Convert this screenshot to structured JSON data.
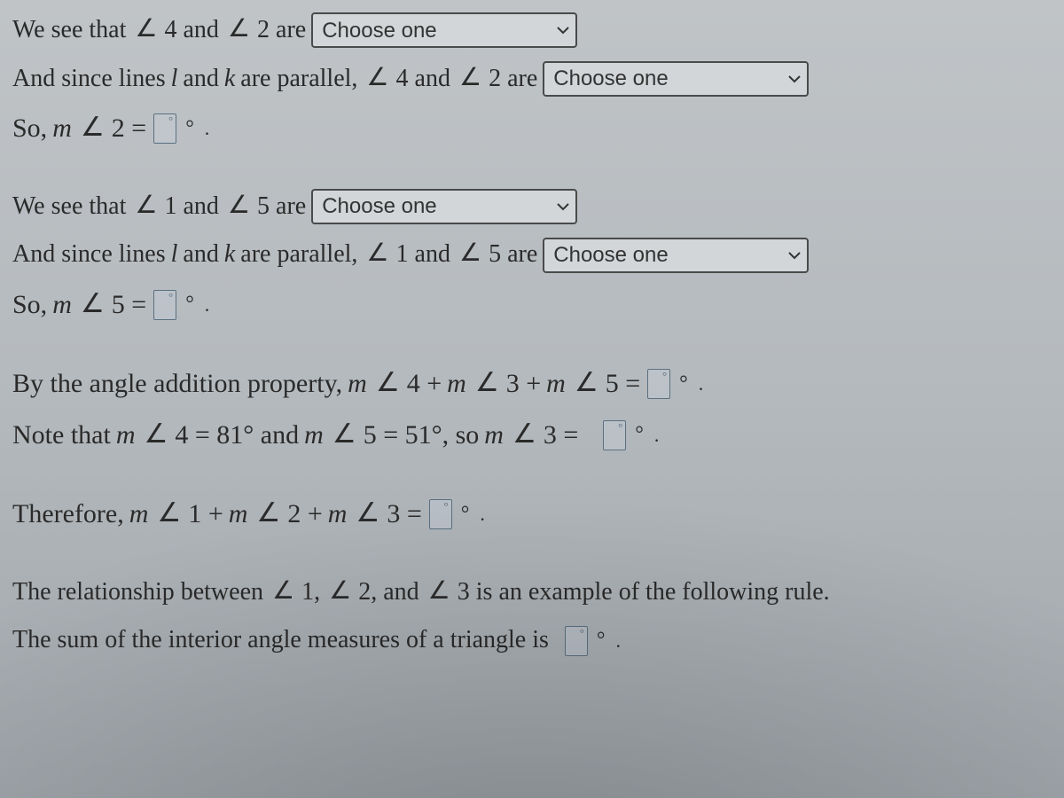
{
  "symbols": {
    "angle": "∠",
    "deg": "°",
    "period": "."
  },
  "selects": {
    "placeholder": "Choose one"
  },
  "block1": {
    "line1_a": "We see that ",
    "line1_b": " 4 and ",
    "line1_c": " 2 are",
    "line2_a": "And since lines ",
    "line2_l": "l",
    "line2_b": " and ",
    "line2_k": "k",
    "line2_c": " are parallel, ",
    "line2_d": " 4 and ",
    "line2_e": " 2 are",
    "line3_a": "So, ",
    "line3_m": "m",
    "line3_b": " 2 ="
  },
  "block2": {
    "line1_a": "We see that ",
    "line1_b": " 1 and ",
    "line1_c": " 5 are",
    "line2_a": "And since lines ",
    "line2_l": "l",
    "line2_b": " and ",
    "line2_k": "k",
    "line2_c": " are parallel, ",
    "line2_d": " 1 and ",
    "line2_e": " 5 are",
    "line3_a": "So, ",
    "line3_m": "m",
    "line3_b": " 5 ="
  },
  "block3": {
    "line1_a": "By the angle addition property, ",
    "line1_m1": "m",
    "line1_b": " 4 + ",
    "line1_m2": "m",
    "line1_c": " 3 + ",
    "line1_m3": "m",
    "line1_d": " 5 =",
    "line2_a": "Note that ",
    "line2_m1": "m",
    "line2_b": " 4 = 81° and ",
    "line2_m2": "m",
    "line2_c": " 5 = 51°, so ",
    "line2_m3": "m",
    "line2_d": " 3 ="
  },
  "block4": {
    "line1_a": "Therefore, ",
    "line1_m1": "m",
    "line1_b": " 1 + ",
    "line1_m2": "m",
    "line1_c": " 2 + ",
    "line1_m3": "m",
    "line1_d": " 3 ="
  },
  "block5": {
    "line1_a": "The relationship between ",
    "line1_b": " 1, ",
    "line1_c": " 2, and ",
    "line1_d": " 3 is an example of the following rule.",
    "line2_a": "The sum of the interior angle measures of a triangle is"
  }
}
